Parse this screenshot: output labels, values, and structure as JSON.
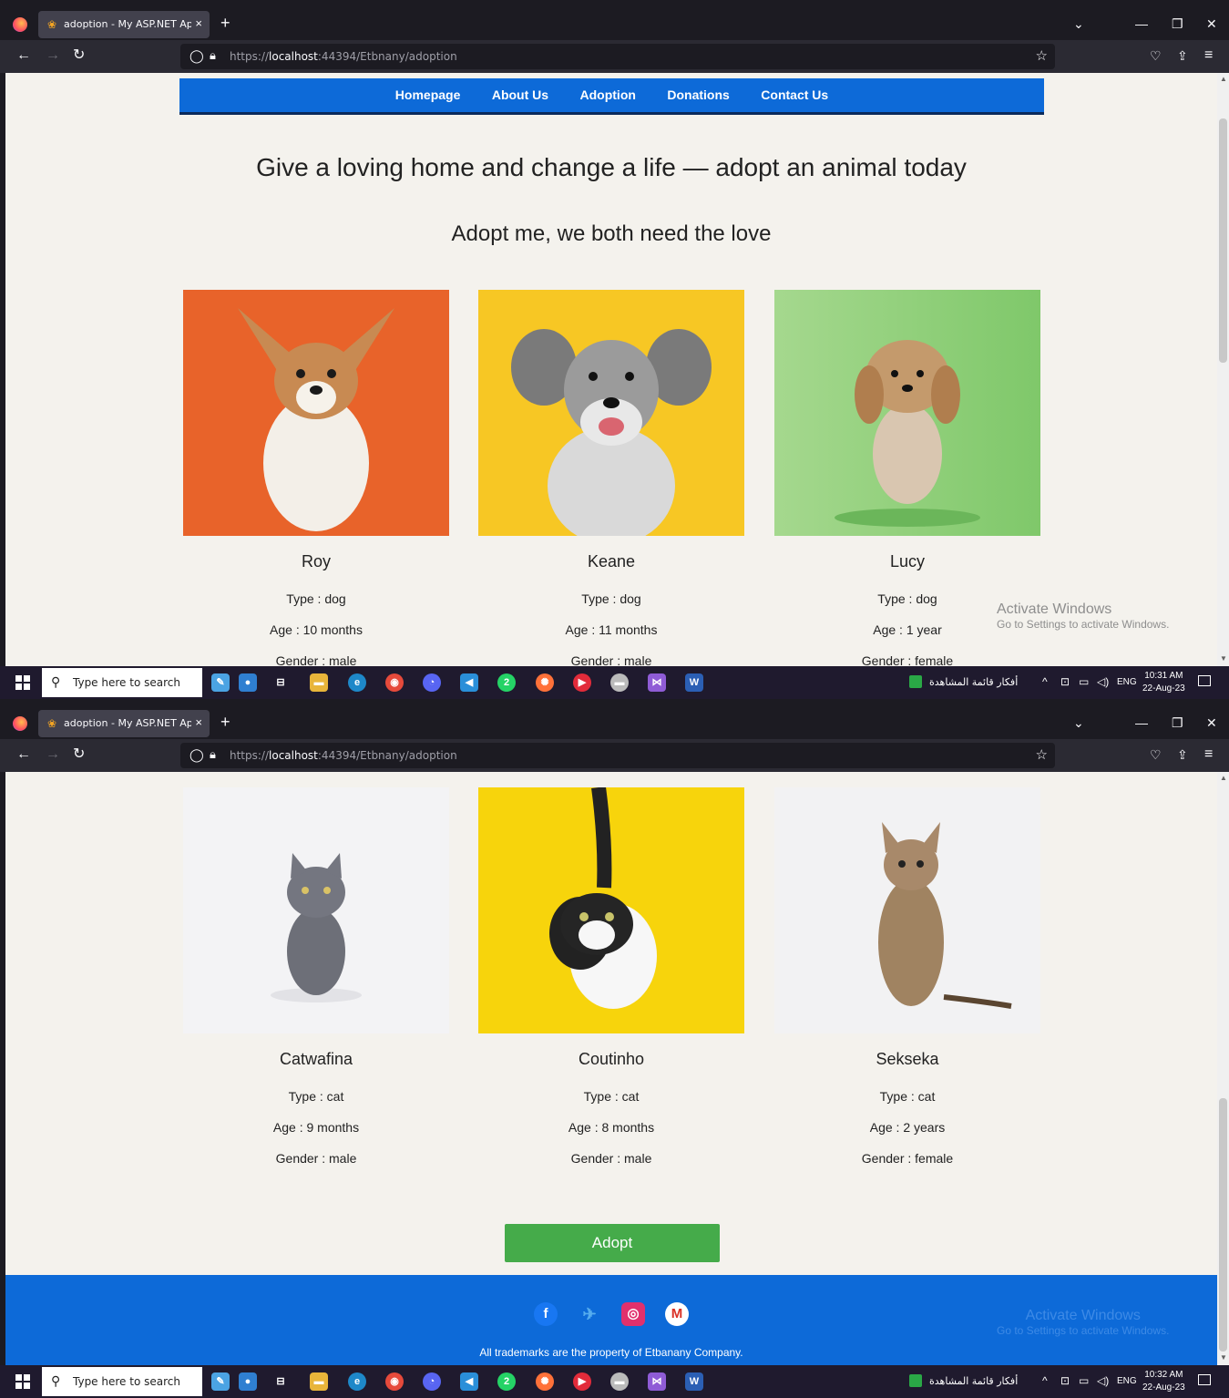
{
  "browser": {
    "tab_title": "adoption - My ASP.NET Applica",
    "tab_close": "×",
    "new_tab": "+",
    "url_prefix": "https://",
    "url_host": "localhost",
    "url_rest": ":44394/Etbnany/adoption"
  },
  "site": {
    "nav": [
      "Homepage",
      "About Us",
      "Adoption",
      "Donations",
      "Contact Us"
    ],
    "headline": "Give a loving home and change a life — adopt an animal today",
    "subheadline": "Adopt me, we both need the love",
    "pets": [
      {
        "name": "Roy",
        "type": "Type : dog",
        "age": "Age : 10 months",
        "gender": "Gender : male",
        "bg": "#e8632a"
      },
      {
        "name": "Keane",
        "type": "Type : dog",
        "age": "Age : 11 months",
        "gender": "Gender : male",
        "bg": "#f7c724"
      },
      {
        "name": "Lucy",
        "type": "Type : dog",
        "age": "Age : 1 year",
        "gender": "Gender : female",
        "bg": "#8fcf7a"
      },
      {
        "name": "Catwafina",
        "type": "Type : cat",
        "age": "Age : 9 months",
        "gender": "Gender : male",
        "bg": "#f3f3f5"
      },
      {
        "name": "Coutinho",
        "type": "Type : cat",
        "age": "Age : 8 months",
        "gender": "Gender : male",
        "bg": "#f7d40c"
      },
      {
        "name": "Sekseka",
        "type": "Type : cat",
        "age": "Age : 2 years",
        "gender": "Gender : female",
        "bg": "#f2f2f3"
      }
    ],
    "adopt_button": "Adopt",
    "footer_text": "All trademarks are the property of Etbanany Company.",
    "social": [
      "facebook-icon",
      "twitter-icon",
      "instagram-icon",
      "gmail-icon"
    ]
  },
  "watermark": {
    "title": "Activate Windows",
    "subtitle": "Go to Settings to activate Windows."
  },
  "taskbar": {
    "search_placeholder": "Type here to search",
    "tray_text": "أفكار قائمة المشاهدة",
    "lang": "ENG",
    "shot1_time": "10:31 AM",
    "shot2_time": "10:32 AM",
    "date": "22-Aug-23",
    "whatsapp_badge": "2"
  },
  "colors": {
    "site_nav": "#0d6ad8",
    "adopt": "#45ab4a",
    "page_bg": "#f4f2ed"
  }
}
